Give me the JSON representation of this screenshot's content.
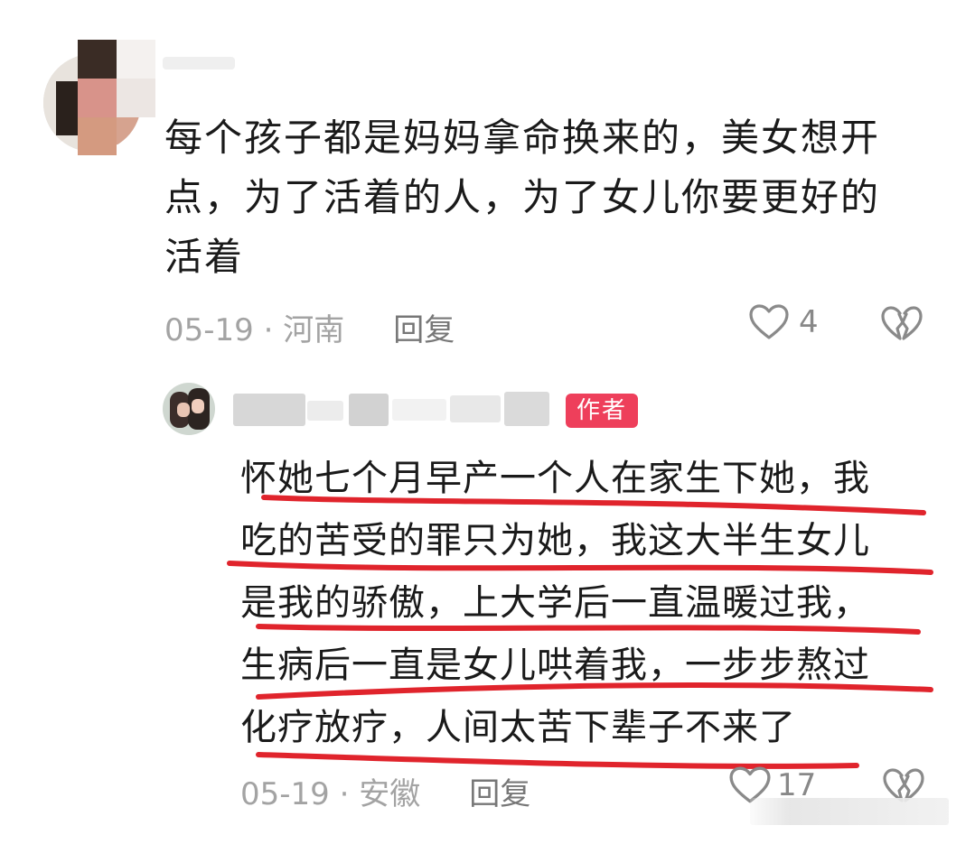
{
  "comments": [
    {
      "text": "每个孩子都是妈妈拿命换来的，美女想开点，为了活着的人，为了女儿你要更好的活着",
      "text_lines": [
        "每个孩子都是妈妈拿命换来的，美女想开",
        "点，为了活着的人，为了女儿你要更好的",
        "活着"
      ],
      "date": "05-19",
      "location": "河南",
      "meta": "05-19 · 河南",
      "reply_label": "回复",
      "likes": "4",
      "like_icon": "heart-outline-icon",
      "dislike_icon": "broken-heart-icon"
    },
    {
      "author_badge": "作者",
      "text_lines": [
        "怀她七个月早产一个人在家生下她，我",
        "吃的苦受的罪只为她，我这大半生女儿",
        "是我的骄傲，上大学后一直温暖过我，",
        "生病后一直是女儿哄着我，一步步熬过",
        "化疗放疗，人间太苦下辈子不来了"
      ],
      "date": "05-19",
      "location": "安徽",
      "meta": "05-19 · 安徽",
      "reply_label": "回复",
      "likes": "17",
      "like_icon": "heart-outline-icon",
      "dislike_icon": "broken-heart-icon"
    }
  ],
  "colors": {
    "badge_bg": "#ee3f5b",
    "underline": "#e0242c",
    "meta_text": "#a3a3a3"
  }
}
